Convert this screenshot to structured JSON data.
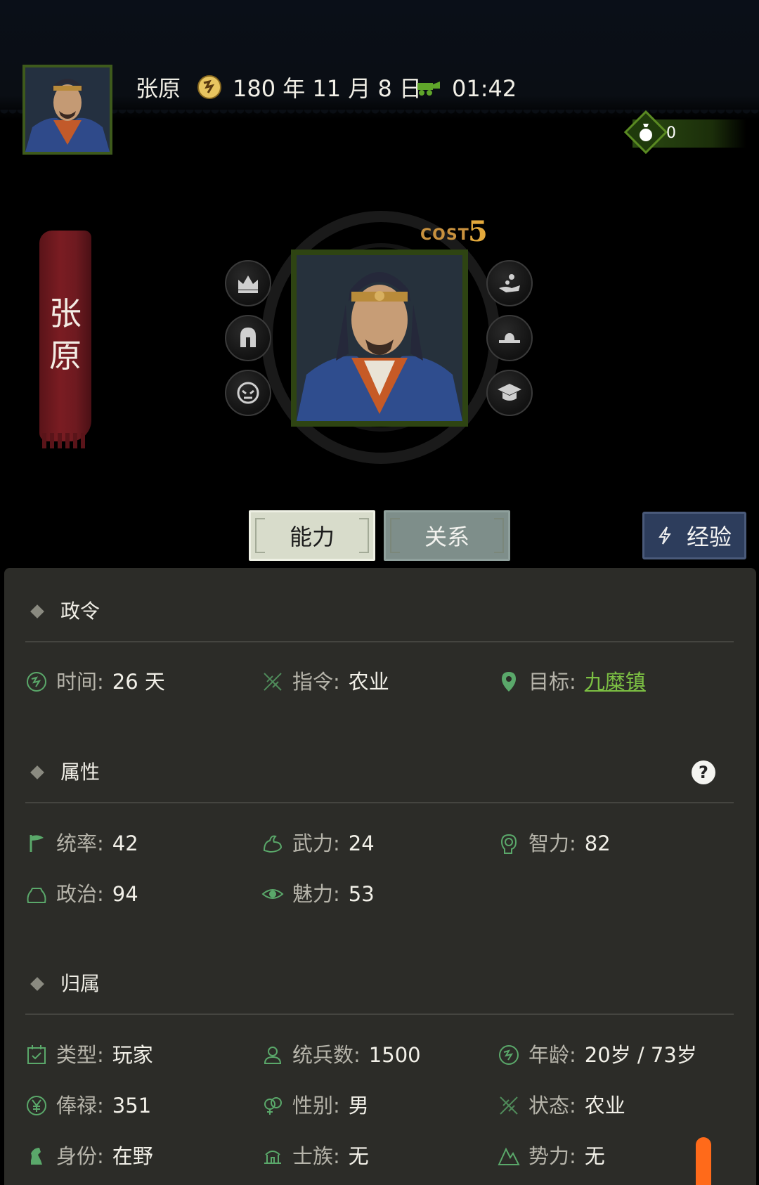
{
  "header": {
    "name": "张原",
    "date": "180 年 11 月 8 日",
    "time": "01:42",
    "money": "0"
  },
  "banner": {
    "char1": "张",
    "char2": "原"
  },
  "card": {
    "cost_label": "COST",
    "cost_value": "5"
  },
  "tabs": {
    "ability": "能力",
    "relation": "关系",
    "experience": "经验"
  },
  "sections": {
    "decree": {
      "title": "政令",
      "time_label": "时间",
      "time_value": "26 天",
      "order_label": "指令",
      "order_value": "农业",
      "target_label": "目标",
      "target_value": "九糜镇"
    },
    "attributes": {
      "title": "属性",
      "help": "?",
      "command_label": "统率",
      "command_value": "42",
      "force_label": "武力",
      "force_value": "24",
      "intelligence_label": "智力",
      "intelligence_value": "82",
      "politics_label": "政治",
      "politics_value": "94",
      "charm_label": "魅力",
      "charm_value": "53"
    },
    "affiliation": {
      "title": "归属",
      "type_label": "类型",
      "type_value": "玩家",
      "troops_label": "统兵数",
      "troops_value": "1500",
      "age_label": "年龄",
      "age_value": "20岁 / 73岁",
      "salary_label": "俸禄",
      "salary_value": "351",
      "gender_label": "性别",
      "gender_value": "男",
      "status_label": "状态",
      "status_value": "农业",
      "identity_label": "身份",
      "identity_value": "在野",
      "clan_label": "士族",
      "clan_value": "无",
      "faction_label": "势力",
      "faction_value": "无"
    }
  },
  "colors": {
    "accent_green": "#7cc043",
    "banner_red": "#7a1c22",
    "panel_bg": "#2c2c28",
    "exp_button": "#2d3d5c"
  }
}
